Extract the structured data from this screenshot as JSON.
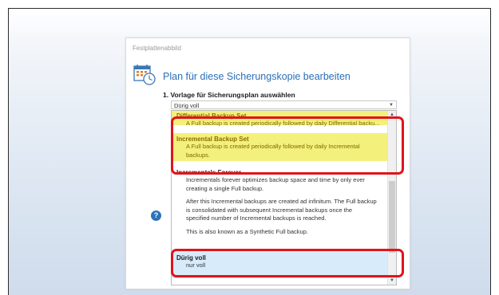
{
  "dialog": {
    "title": "Festplattenabbild",
    "plan_title": "Plan für diese Sicherungskopie bearbeiten",
    "step_label": "1. Vorlage für Sicherungsplan auswählen",
    "help_icon": "?"
  },
  "select": {
    "value": "Dürig voll",
    "arrow_icon": "chevron-down-icon"
  },
  "options": [
    {
      "title": "Differential Backup Set",
      "desc": [
        "A Full backup is created periodically followed by daily Differential backu..."
      ]
    },
    {
      "title": "Incremental Backup Set",
      "desc": [
        "A Full backup is created periodically followed by daily Incremental",
        "backups."
      ]
    },
    {
      "title": "Incrementals Forever",
      "desc": [
        "Incrementals forever optimizes backup space and time by only ever",
        "creating a single Full backup.",
        "",
        "After this Incremental backups are created ad infinitum. The Full backup",
        "is consolidated with subsequent Incremental backups once the",
        "specified number of Incremental backups is reached.",
        "",
        "This is also known as a Synthetic Full backup."
      ]
    },
    {
      "title": "Dürig voll",
      "desc": [
        "nur voll"
      ]
    }
  ],
  "colors": {
    "highlight": "#f4f07c",
    "selection": "#d7ebfb",
    "annotation_red": "#e0141c",
    "accent_blue": "#2b6fb8"
  }
}
